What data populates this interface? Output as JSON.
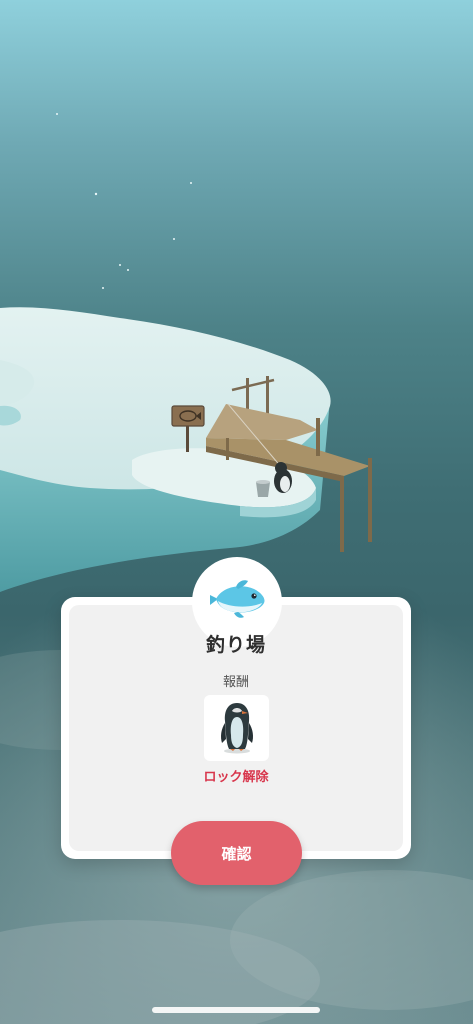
{
  "dialog": {
    "icon": "fish-icon",
    "title": "釣り場",
    "reward_label": "報酬",
    "reward_icon": "penguin-icon",
    "unlock_text": "ロック解除",
    "confirm_label": "確認"
  },
  "colors": {
    "confirm_button": "#e2616c",
    "unlock_text": "#d8364c",
    "fish": "#5cc6e6"
  }
}
